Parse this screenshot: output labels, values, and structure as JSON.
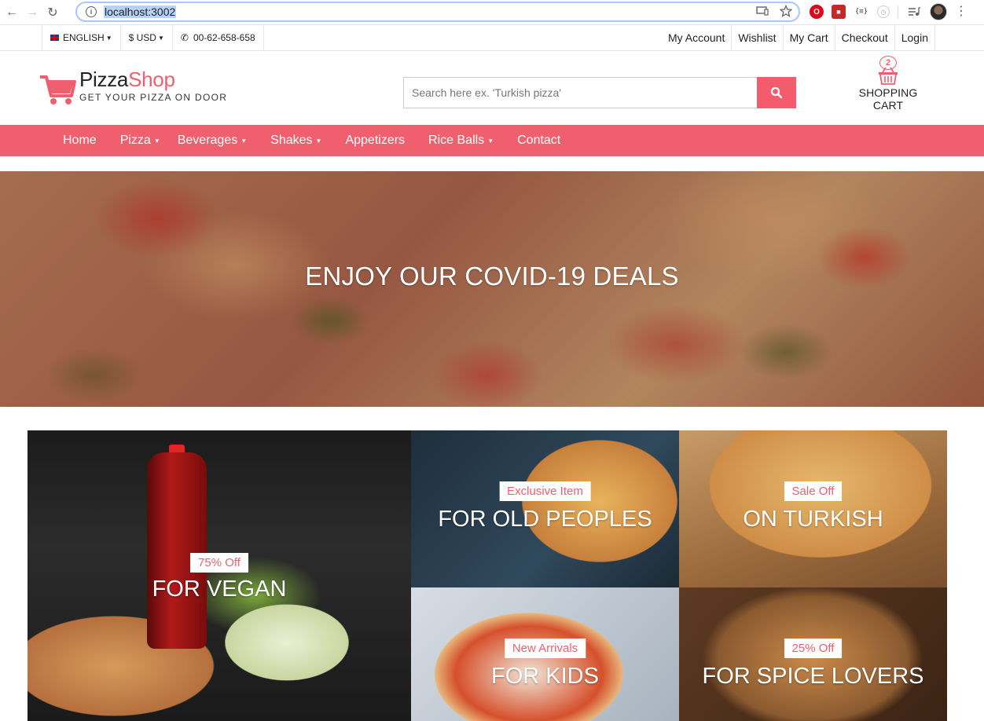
{
  "browser": {
    "url": "localhost:3002"
  },
  "topbar": {
    "language": "ENGLISH",
    "currency": "$ USD",
    "phone": "00-62-658-658",
    "links": [
      "My Account",
      "Wishlist",
      "My Cart",
      "Checkout",
      "Login"
    ]
  },
  "header": {
    "brand_first": "Pizza",
    "brand_second": "Shop",
    "tagline": "GET YOUR PIZZA ON DOOR",
    "search_placeholder": "Search here ex. 'Turkish pizza'",
    "cart_count": "2",
    "cart_label": "SHOPPING CART"
  },
  "nav": {
    "items": [
      {
        "label": "Home"
      },
      {
        "label": "Pizza"
      },
      {
        "label": "Beverages"
      },
      {
        "label": "Shakes"
      },
      {
        "label": "Appetizers"
      },
      {
        "label": "Rice Balls"
      },
      {
        "label": "Contact"
      }
    ]
  },
  "hero": {
    "title": "ENJOY OUR COVID-19 DEALS"
  },
  "tiles": [
    {
      "badge": "75% Off",
      "title": "FOR VEGAN"
    },
    {
      "badge": "Exclusive Item",
      "title": "FOR OLD PEOPLES"
    },
    {
      "badge": "Sale Off",
      "title": "ON TURKISH"
    },
    {
      "badge": "New Arrivals",
      "title": "FOR KIDS"
    },
    {
      "badge": "25% Off",
      "title": "FOR SPICE LOVERS"
    }
  ],
  "colors": {
    "accent": "#f05f6e"
  }
}
